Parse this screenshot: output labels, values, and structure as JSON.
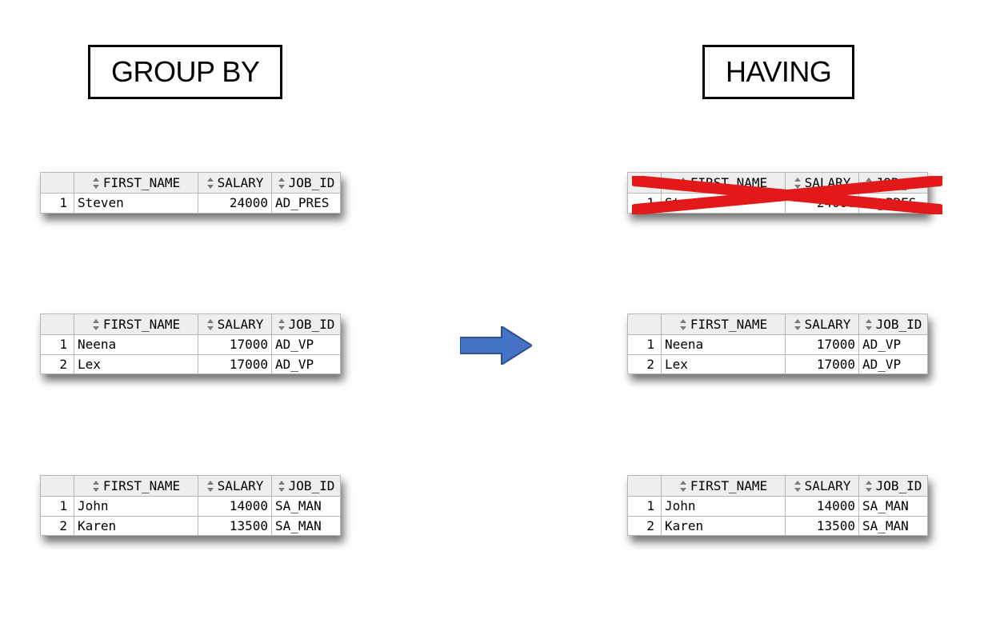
{
  "titles": {
    "left": "GROUP BY",
    "right": "HAVING"
  },
  "headers": {
    "rownum": "",
    "first": "FIRST_NAME",
    "salary": "SALARY",
    "job": "JOB_ID"
  },
  "left": {
    "t1": {
      "rows": [
        {
          "n": "1",
          "first": "Steven",
          "salary": "24000",
          "job": "AD_PRES"
        }
      ]
    },
    "t2": {
      "rows": [
        {
          "n": "1",
          "first": "Neena",
          "salary": "17000",
          "job": "AD_VP"
        },
        {
          "n": "2",
          "first": "Lex",
          "salary": "17000",
          "job": "AD_VP"
        }
      ]
    },
    "t3": {
      "rows": [
        {
          "n": "1",
          "first": "John",
          "salary": "14000",
          "job": "SA_MAN"
        },
        {
          "n": "2",
          "first": "Karen",
          "salary": "13500",
          "job": "SA_MAN"
        }
      ]
    }
  },
  "right": {
    "t1": {
      "crossed_out": true,
      "rows": [
        {
          "n": "1",
          "first": "Steven",
          "salary": "24000",
          "job": "AD_PRES"
        }
      ]
    },
    "t2": {
      "rows": [
        {
          "n": "1",
          "first": "Neena",
          "salary": "17000",
          "job": "AD_VP"
        },
        {
          "n": "2",
          "first": "Lex",
          "salary": "17000",
          "job": "AD_VP"
        }
      ]
    },
    "t3": {
      "rows": [
        {
          "n": "1",
          "first": "John",
          "salary": "14000",
          "job": "SA_MAN"
        },
        {
          "n": "2",
          "first": "Karen",
          "salary": "13500",
          "job": "SA_MAN"
        }
      ]
    }
  },
  "arrow": {
    "fill": "#4472c4",
    "stroke": "#2f528f"
  },
  "cross": {
    "stroke": "#e31919",
    "width": 14
  }
}
